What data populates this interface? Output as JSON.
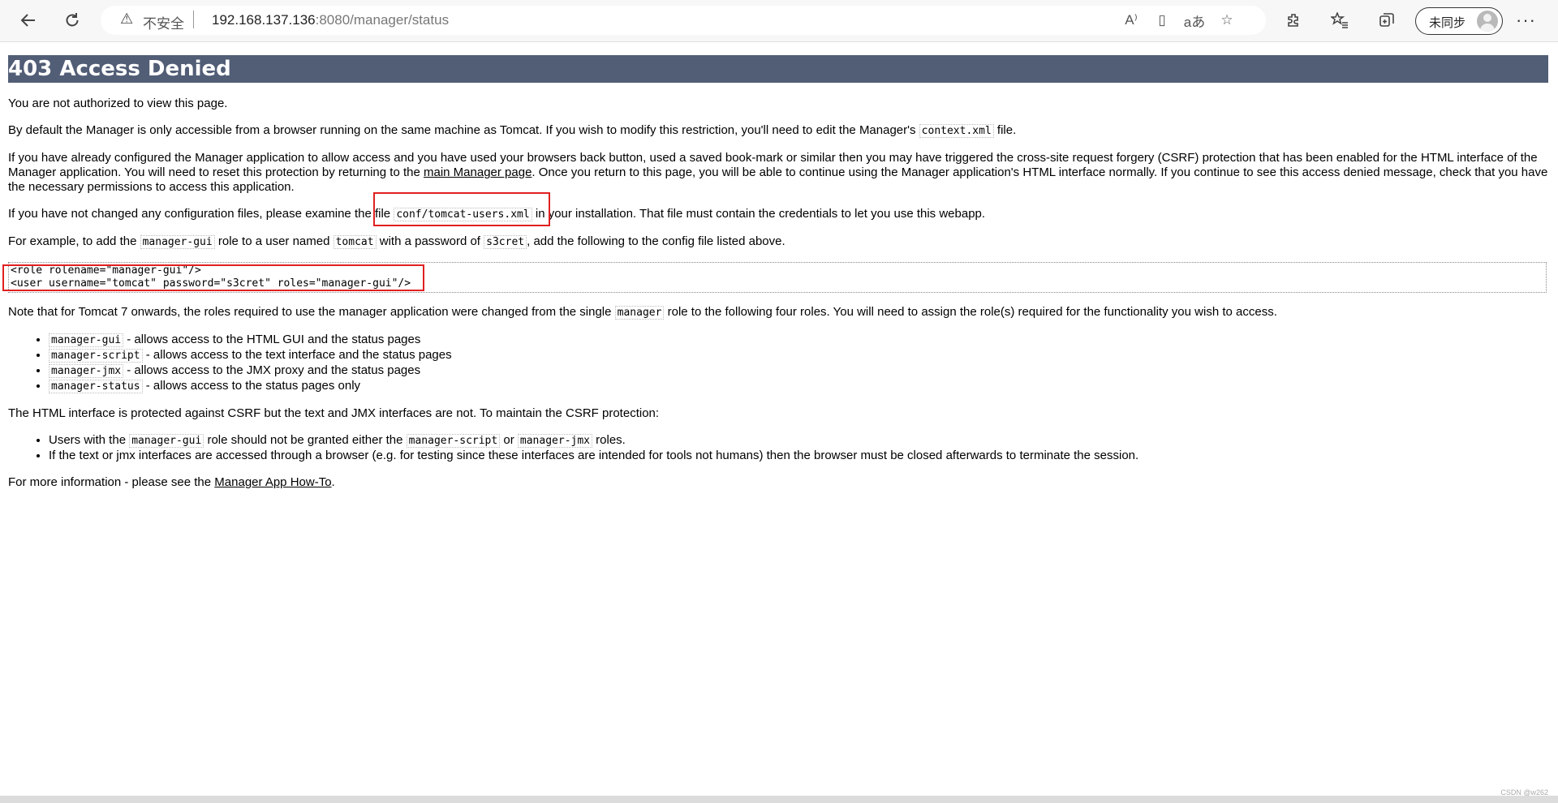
{
  "browser": {
    "security_label": "不安全",
    "url_host": "192.168.137.136",
    "url_rest": ":8080/manager/status",
    "sync_label": "未同步"
  },
  "page": {
    "title": "403 Access Denied",
    "p1": "You are not authorized to view this page.",
    "p2_a": "By default the Manager is only accessible from a browser running on the same machine as Tomcat. If you wish to modify this restriction, you'll need to edit the Manager's ",
    "p2_code": "context.xml",
    "p2_b": " file.",
    "p3_a": "If you have already configured the Manager application to allow access and you have used your browsers back button, used a saved book-mark or similar then you may have triggered the cross-site request forgery (CSRF) protection that has been enabled for the HTML interface of the Manager application. You will need to reset this protection by returning to the ",
    "p3_link": "main Manager page",
    "p3_b": ". Once you return to this page, you will be able to continue using the Manager application's HTML interface normally. If you continue to see this access denied message, check that you have the necessary permissions to access this application.",
    "p4_a": "If you have not changed any configuration files, please examine the file ",
    "p4_code": "conf/tomcat-users.xml",
    "p4_b": " in your installation. That file must contain the credentials to let you use this webapp.",
    "p5_a": "For example, to add the ",
    "p5_code1": "manager-gui",
    "p5_b": " role to a user named ",
    "p5_code2": "tomcat",
    "p5_c": " with a password of ",
    "p5_code3": "s3cret",
    "p5_d": ", add the following to the config file listed above.",
    "snippet_line1": "<role rolename=\"manager-gui\"/>",
    "snippet_line2": "<user username=\"tomcat\" password=\"s3cret\" roles=\"manager-gui\"/>",
    "p6_a": "Note that for Tomcat 7 onwards, the roles required to use the manager application were changed from the single ",
    "p6_code": "manager",
    "p6_b": " role to the following four roles. You will need to assign the role(s) required for the functionality you wish to access.",
    "roles": [
      {
        "code": "manager-gui",
        "text": " - allows access to the HTML GUI and the status pages"
      },
      {
        "code": "manager-script",
        "text": " - allows access to the text interface and the status pages"
      },
      {
        "code": "manager-jmx",
        "text": " - allows access to the JMX proxy and the status pages"
      },
      {
        "code": "manager-status",
        "text": " - allows access to the status pages only"
      }
    ],
    "p7": "The HTML interface is protected against CSRF but the text and JMX interfaces are not. To maintain the CSRF protection:",
    "csrf_1_a": "Users with the ",
    "csrf_1_code1": "manager-gui",
    "csrf_1_b": " role should not be granted either the ",
    "csrf_1_code2": "manager-script",
    "csrf_1_c": " or ",
    "csrf_1_code3": "manager-jmx",
    "csrf_1_d": " roles.",
    "csrf_2": "If the text or jmx interfaces are accessed through a browser (e.g. for testing since these interfaces are intended for tools not humans) then the browser must be closed afterwards to terminate the session.",
    "p8_a": "For more information - please see the ",
    "p8_link": "Manager App How-To",
    "p8_b": "."
  },
  "watermark": "CSDN @w262",
  "colors": {
    "banner": "#525d76",
    "highlight_box": "#e02020"
  }
}
